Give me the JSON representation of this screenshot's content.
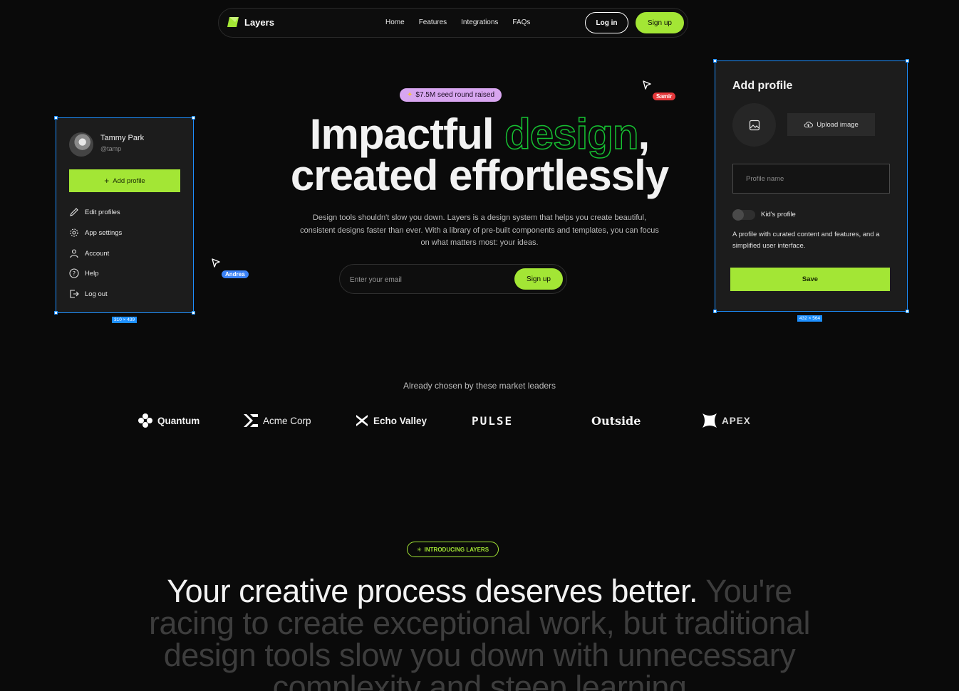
{
  "nav": {
    "brand": "Layers",
    "links": [
      "Home",
      "Features",
      "Integrations",
      "FAQs"
    ],
    "login_label": "Log in",
    "signup_label": "Sign up"
  },
  "hero": {
    "badge": "$7.5M seed round raised",
    "title_part1": "Impactful ",
    "title_highlight": "design",
    "title_part2": ",",
    "title_line2": "created effortlessly",
    "description": "Design tools shouldn't slow you down. Layers is a design system that helps you create beautiful, consistent designs faster than ever. With a library of pre-built components and templates, you can focus on what matters most: your ideas.",
    "email_placeholder": "Enter your email",
    "signup_label": "Sign up"
  },
  "cursors": [
    {
      "name": "Samir",
      "color": "#e5383b"
    },
    {
      "name": "Andrea",
      "color": "#3b82f6"
    }
  ],
  "profile_menu": {
    "user_name": "Tammy Park",
    "user_handle": "@tamp",
    "add_profile_label": "Add profile",
    "items": [
      "Edit profiles",
      "App settings",
      "Account",
      "Help",
      "Log out"
    ],
    "dimensions_label": "310 × 439"
  },
  "add_profile_panel": {
    "title": "Add profile",
    "upload_label": "Upload image",
    "name_placeholder": "Profile name",
    "toggle_label": "Kid's profile",
    "toggle_on": false,
    "description": "A profile with curated content and features, and a simplified user interface.",
    "save_label": "Save",
    "dimensions_label": "432 × 564"
  },
  "leaders": {
    "title": "Already chosen by these market leaders",
    "logos": [
      "Quantum",
      "Acme Corp",
      "Echo Valley",
      "PULSE",
      "Outside",
      "APEX"
    ]
  },
  "intro": {
    "badge": "INTRODUCING LAYERS",
    "headline_bright": "Your creative process deserves better.",
    "headline_dim": " You're racing to create exceptional work, but traditional design tools slow you down with unnecessary complexity and steep learning"
  },
  "colors": {
    "accent": "#a3e635",
    "outline_green": "#16c232",
    "background": "#0a0a0a",
    "card": "#1c1c1c",
    "selection": "#1e90ff"
  }
}
